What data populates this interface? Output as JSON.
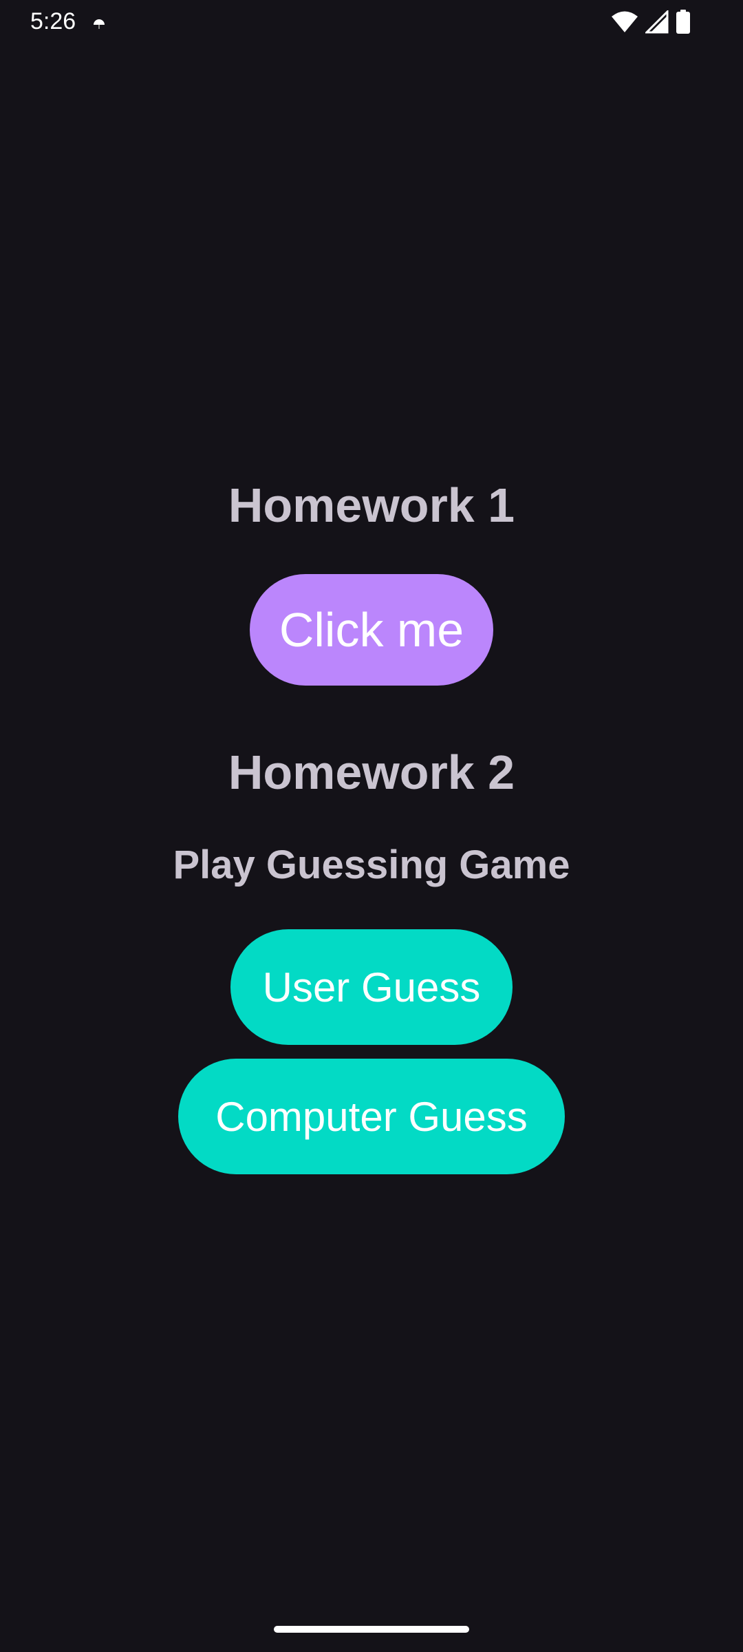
{
  "status_bar": {
    "time": "5:26",
    "icons": [
      "notification-icon",
      "wifi-icon",
      "signal-icon",
      "battery-icon"
    ]
  },
  "homework1": {
    "title": "Homework 1",
    "button_label": "Click me"
  },
  "homework2": {
    "title": "Homework 2",
    "subtitle": "Play Guessing Game",
    "user_guess_label": "User Guess",
    "computer_guess_label": "Computer Guess"
  },
  "colors": {
    "background": "#141218",
    "heading_text": "#cac4d0",
    "primary_button": "#bb86fc",
    "secondary_button": "#03dac5",
    "button_text": "#ffffff"
  }
}
